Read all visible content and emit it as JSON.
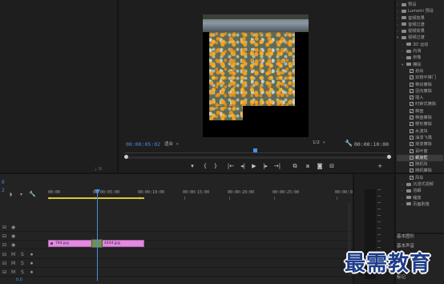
{
  "program_monitor": {
    "timecode": "00:00:05:02",
    "duration": "00:00:10:00",
    "fit": "适合",
    "resolution": "1/2"
  },
  "effects_tree": [
    {
      "label": "预设",
      "level": 1,
      "type": "folder",
      "expanded": false
    },
    {
      "label": "Lumetri 预设",
      "level": 1,
      "type": "folder",
      "expanded": false
    },
    {
      "label": "音频效果",
      "level": 1,
      "type": "folder",
      "expanded": false
    },
    {
      "label": "音频过渡",
      "level": 1,
      "type": "folder",
      "expanded": false
    },
    {
      "label": "视频效果",
      "level": 1,
      "type": "folder",
      "expanded": false
    },
    {
      "label": "视频过渡",
      "level": 1,
      "type": "folder",
      "expanded": true
    },
    {
      "label": "3D 运动",
      "level": 2,
      "type": "folder",
      "expanded": false
    },
    {
      "label": "内滑",
      "level": 2,
      "type": "folder",
      "expanded": false
    },
    {
      "label": "划像",
      "level": 2,
      "type": "folder",
      "expanded": false
    },
    {
      "label": "擦除",
      "level": 2,
      "type": "folder",
      "expanded": true
    },
    {
      "label": "划出",
      "level": 3,
      "type": "effect"
    },
    {
      "label": "双侧平推门",
      "level": 3,
      "type": "effect"
    },
    {
      "label": "带状擦除",
      "level": 3,
      "type": "effect"
    },
    {
      "label": "径向擦除",
      "level": 3,
      "type": "effect"
    },
    {
      "label": "插入",
      "level": 3,
      "type": "effect"
    },
    {
      "label": "时钟式擦除",
      "level": 3,
      "type": "effect"
    },
    {
      "label": "棋盘",
      "level": 3,
      "type": "effect"
    },
    {
      "label": "棋盘擦除",
      "level": 3,
      "type": "effect"
    },
    {
      "label": "楔形擦除",
      "level": 3,
      "type": "effect"
    },
    {
      "label": "水波块",
      "level": 3,
      "type": "effect"
    },
    {
      "label": "油漆飞溅",
      "level": 3,
      "type": "effect"
    },
    {
      "label": "渐变擦除",
      "level": 3,
      "type": "effect"
    },
    {
      "label": "百叶窗",
      "level": 3,
      "type": "effect"
    },
    {
      "label": "螺旋框",
      "level": 3,
      "type": "effect",
      "selected": true
    },
    {
      "label": "随机块",
      "level": 3,
      "type": "effect"
    },
    {
      "label": "随机擦除",
      "level": 3,
      "type": "effect"
    },
    {
      "label": "风车",
      "level": 3,
      "type": "effect"
    },
    {
      "label": "沉浸式视频",
      "level": 2,
      "type": "folder",
      "expanded": false
    },
    {
      "label": "溶解",
      "level": 2,
      "type": "folder",
      "expanded": false
    },
    {
      "label": "缩放",
      "level": 2,
      "type": "folder",
      "expanded": false
    },
    {
      "label": "页面剥落",
      "level": 2,
      "type": "folder",
      "expanded": false
    }
  ],
  "right_panels": {
    "essential_graphics": "基本图形",
    "essential_sound": "基本声音",
    "markers": "标记"
  },
  "timeline": {
    "timecode": "0",
    "ticks": [
      "00:00",
      "00:00:05:00",
      "00:00:10:00",
      "00:00:15:00",
      "00:00:20:00",
      "00:00:25:00",
      "00:00:30"
    ],
    "clips": [
      {
        "name": "784.jpg"
      },
      {
        "name": "4444.jpg"
      }
    ],
    "audio_track_label": "M",
    "solo_label": "S",
    "master_value": "0.0"
  },
  "watermark": "最需教育"
}
